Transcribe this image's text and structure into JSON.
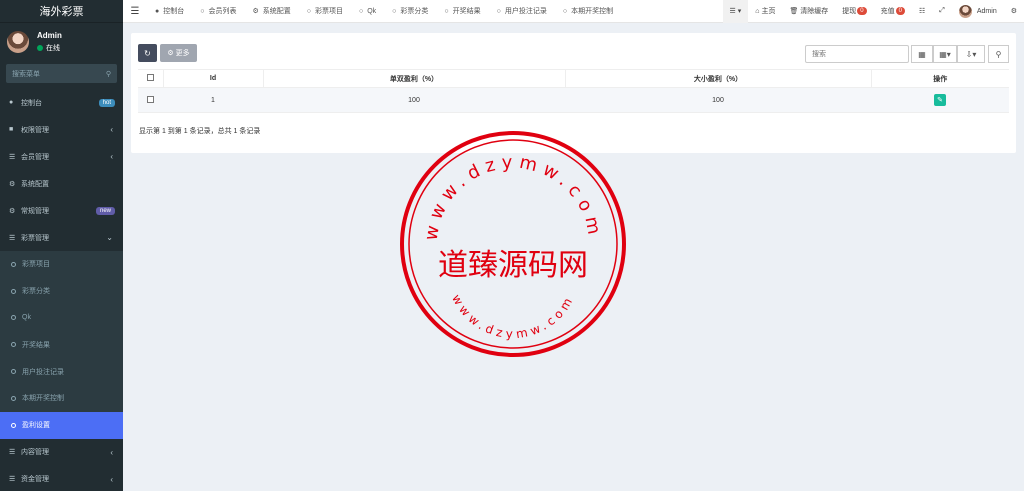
{
  "brand": "海外彩票",
  "user": {
    "name": "Admin",
    "status": "在线"
  },
  "sidebar": {
    "search_placeholder": "搜索菜单",
    "items": [
      {
        "label": "控制台",
        "badge": "hot"
      },
      {
        "label": "权限管理",
        "arrow": "‹"
      },
      {
        "label": "会员管理",
        "arrow": "‹"
      },
      {
        "label": "系统配置"
      },
      {
        "label": "常规管理",
        "badge": "new"
      },
      {
        "label": "彩票管理",
        "arrow": "⌄"
      }
    ],
    "sub_items": [
      "彩票项目",
      "彩票分类",
      "Qk",
      "开奖结果",
      "用户投注记录",
      "本期开奖控制",
      "盈利设置"
    ],
    "bottom_items": [
      {
        "label": "内容管理",
        "arrow": "‹"
      },
      {
        "label": "资金管理",
        "arrow": "‹"
      }
    ]
  },
  "topbar": {
    "tabs": [
      "控制台",
      "会员列表",
      "系统配置",
      "彩票项目",
      "Qk",
      "彩票分类",
      "开奖结果",
      "用户投注记录",
      "本期开奖控制"
    ],
    "home": "主页",
    "clear_cache": "清除缓存",
    "withdraw": "提现",
    "withdraw_count": "0",
    "recharge": "充值",
    "recharge_count": "0",
    "admin": "Admin"
  },
  "panel": {
    "more_label": "更多",
    "search_placeholder": "搜索",
    "columns": [
      "Id",
      "单双盈利（%）",
      "大小盈利（%）",
      "操作"
    ],
    "rows": [
      {
        "id": "1",
        "odd_even": "100",
        "big_small": "100"
      }
    ],
    "pagination": "显示第 1 到第 1 条记录，总共 1 条记录"
  },
  "watermark": {
    "center_text": "道臻源码网",
    "ring_text_top": "www.dzymw.com",
    "ring_text_bottom": "www.dzymw.com"
  },
  "colors": {
    "sidebar": "#222d32",
    "active_item": "#4c6ef5",
    "stamp": "#e00010",
    "edit": "#18bc9c"
  }
}
